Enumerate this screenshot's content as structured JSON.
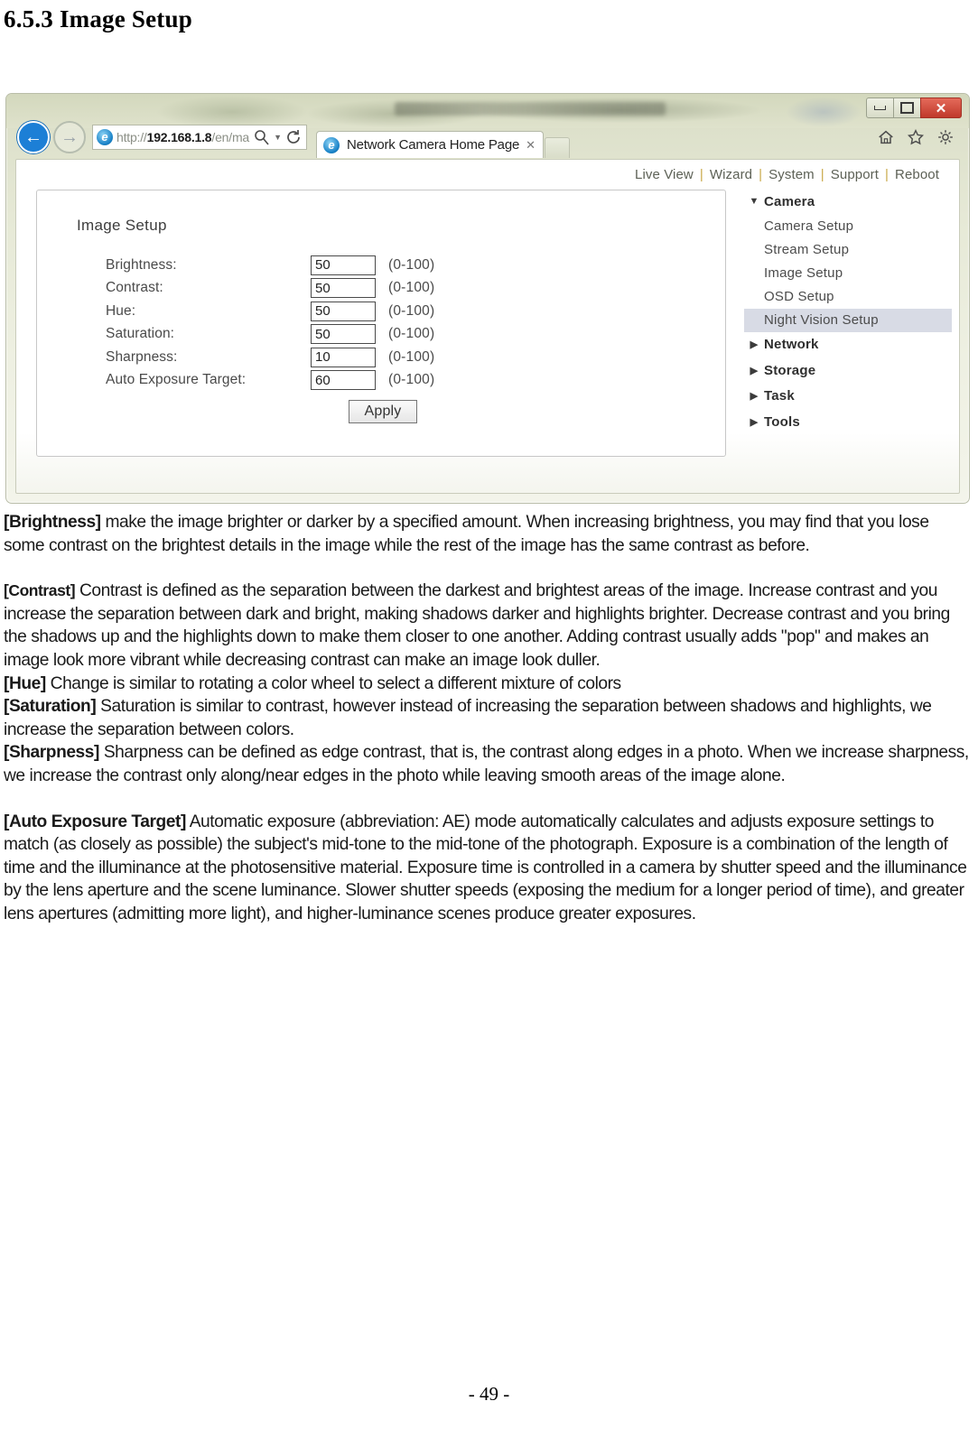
{
  "document": {
    "heading": "6.5.3 Image Setup",
    "page_footer": "- 49 -"
  },
  "screenshot": {
    "browser": {
      "window_controls": {
        "minimize": "—",
        "maximize": "▢",
        "close": "✕"
      },
      "back_label": "←",
      "forward_label": "→",
      "address": {
        "url_prefix": "http://",
        "url_host": "192.168.1.8",
        "url_path": "/en/ma",
        "search_icon": "search-icon",
        "dropdown_icon": "chevron-down-icon",
        "refresh_icon": "refresh-icon"
      },
      "tab": {
        "title": "Network Camera Home Page",
        "close": "✕"
      },
      "tools": {
        "home": "home-icon",
        "favorites": "star-icon",
        "settings": "gear-icon"
      }
    },
    "page": {
      "topnav": [
        "Live View",
        "Wizard",
        "System",
        "Support",
        "Reboot"
      ],
      "topnav_separator": "|",
      "card_title": "Image Setup",
      "fields": [
        {
          "label": "Brightness:",
          "value": "50",
          "range": "(0-100)"
        },
        {
          "label": "Contrast:",
          "value": "50",
          "range": "(0-100)"
        },
        {
          "label": "Hue:",
          "value": "50",
          "range": "(0-100)"
        },
        {
          "label": "Saturation:",
          "value": "50",
          "range": "(0-100)"
        },
        {
          "label": "Sharpness:",
          "value": "10",
          "range": "(0-100)"
        },
        {
          "label": "Auto Exposure Target:",
          "value": "60",
          "range": "(0-100)"
        }
      ],
      "apply_label": "Apply",
      "sidemenu": {
        "expanded_arrow": "▼",
        "collapsed_arrow": "▶",
        "groups": [
          {
            "label": "Camera",
            "expanded": true,
            "items": [
              {
                "label": "Camera Setup",
                "active": false
              },
              {
                "label": "Stream Setup",
                "active": false
              },
              {
                "label": "Image Setup",
                "active": false
              },
              {
                "label": "OSD Setup",
                "active": false
              },
              {
                "label": "Night Vision Setup",
                "active": true
              }
            ]
          },
          {
            "label": "Network",
            "expanded": false,
            "items": []
          },
          {
            "label": "Storage",
            "expanded": false,
            "items": []
          },
          {
            "label": "Task",
            "expanded": false,
            "items": []
          },
          {
            "label": "Tools",
            "expanded": false,
            "items": []
          }
        ]
      },
      "highlight_color": "#d8dbe5",
      "separator_color": "#c9a94a"
    }
  },
  "body": {
    "brightness": {
      "label": "[Brightness]",
      "text": " make the image brighter or darker by a specified amount. When increasing brightness, you may find that you lose some contrast on the brightest details in the image while the rest of the image has the same contrast as before."
    },
    "contrast": {
      "label": "[Contrast]",
      "text": " Contrast is defined as the separation between the darkest and brightest areas of the image. Increase contrast and you increase the separation between dark and bright, making shadows darker and highlights brighter. Decrease contrast and you bring the shadows up and the highlights down to make them closer to one another. Adding contrast usually adds \"pop\" and makes an image look more vibrant while decreasing contrast can make an image look duller."
    },
    "hue": {
      "label": "[Hue]",
      "text": " Change is similar to rotating a color wheel to select a different mixture of colors"
    },
    "saturation": {
      "label": "[Saturation]",
      "text": " Saturation is similar to contrast, however instead of increasing the separation between shadows and highlights, we increase the separation between colors."
    },
    "sharpness": {
      "label": "[Sharpness]",
      "text": " Sharpness can be defined as edge contrast, that is, the contrast along edges in a photo. When we increase sharpness, we increase the contrast only along/near edges in the photo while leaving smooth areas of the image alone."
    },
    "auto_exposure": {
      "label": "[Auto Exposure Target]",
      "text": " Automatic exposure (abbreviation: AE) mode automatically calculates and adjusts exposure settings to match (as closely as possible) the subject's mid-tone to the mid-tone of the photograph. Exposure is a combination of the length of time and the illuminance at the photosensitive material. Exposure time is controlled in a camera by shutter speed and the illuminance by the lens aperture and the scene luminance. Slower shutter speeds (exposing the medium for a longer period of time), and greater lens apertures (admitting more light), and higher-luminance scenes produce greater exposures."
    }
  }
}
